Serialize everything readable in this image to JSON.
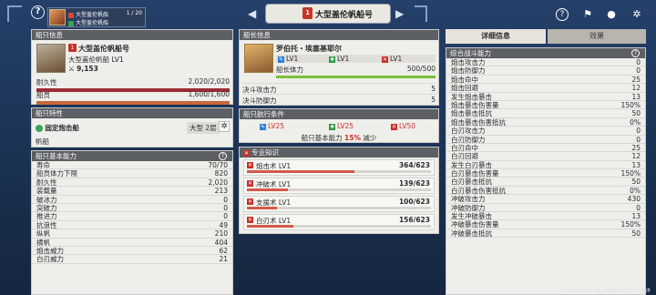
{
  "topbar": {
    "help": "?",
    "ship_card": {
      "name1": "大型盖伦帆船",
      "name2": "大型盖伦帆船",
      "page": "1 / 20"
    },
    "title": "大型盖伦帆船号",
    "title_badge": "1",
    "icons": [
      "question-icon",
      "flag-icon",
      "chat-icon",
      "settings-icon"
    ]
  },
  "ship_info": {
    "header": "船只信息",
    "badge": "1",
    "name": "大型盖伦帆船号",
    "type": "大型盖伦帆船 LV1",
    "power": "9,153",
    "durability_label": "耐久性",
    "durability_value": "2,020/2,020",
    "durability_fill": 1.0,
    "sailors_label": "船员",
    "sailors_value": "1,600/1,600",
    "sailors_fill": 1.0,
    "colors": {
      "durability": "#9c2b36",
      "sailors": "#c7683a"
    }
  },
  "ship_traits": {
    "header": "船只特性",
    "trait": "固定炮击船",
    "size": "大型 2层",
    "kind": "帆船"
  },
  "ship_base": {
    "header": "船只基本能力",
    "rows": [
      {
        "label": "寿命",
        "value": "70/70"
      },
      {
        "label": "船员体力下限",
        "value": "820"
      },
      {
        "label": "耐久性",
        "value": "2,020"
      },
      {
        "label": "装载量",
        "value": "213"
      },
      {
        "label": "破冰力",
        "value": "0"
      },
      {
        "label": "突破力",
        "value": "0"
      },
      {
        "label": "推进力",
        "value": "0"
      },
      {
        "label": "抗浪性",
        "value": "49"
      },
      {
        "label": "纵帆",
        "value": "210"
      },
      {
        "label": "横帆",
        "value": "404"
      },
      {
        "label": "炮击威力",
        "value": "62"
      },
      {
        "label": "白刃威力",
        "value": "21"
      }
    ]
  },
  "captain": {
    "header": "船长信息",
    "name": "罗伯托・埃塞基耶尔",
    "lv1": "LV1",
    "lv2": "LV1",
    "lv3": "LV1",
    "stamina_label": "船长体力",
    "stamina_value": "500/500",
    "stamina_fill": 1.0,
    "atk_label": "决斗攻击力",
    "atk_value": "5",
    "def_label": "决斗防御力",
    "def_value": "5"
  },
  "voyage": {
    "header": "船只航行条件",
    "c1": "LV25",
    "c2": "LV25",
    "c3": "LV50",
    "note_prefix": "船只基本能力",
    "note_pct": "15%",
    "note_suffix": "减少"
  },
  "skills": {
    "header": "专业知识",
    "items": [
      {
        "name": "炮击术 LV1",
        "value": "364/623",
        "fill": 0.584
      },
      {
        "name": "冲破术 LV1",
        "value": "139/623",
        "fill": 0.223
      },
      {
        "name": "支援术 LV1",
        "value": "100/623",
        "fill": 0.161
      },
      {
        "name": "白刃术 LV1",
        "value": "156/623",
        "fill": 0.25
      }
    ]
  },
  "tabs": {
    "detail": "详细信息",
    "effect": "效果"
  },
  "combat": {
    "header": "综合战斗能力",
    "rows": [
      {
        "label": "炮击攻击力",
        "value": "0"
      },
      {
        "label": "炮击防御力",
        "value": "0"
      },
      {
        "label": "炮击命中",
        "value": "25"
      },
      {
        "label": "炮击回避",
        "value": "12"
      },
      {
        "label": "发生炮击暴击",
        "value": "13"
      },
      {
        "label": "炮击暴击伤害量",
        "value": "150%"
      },
      {
        "label": "炮击暴击抵抗",
        "value": "50"
      },
      {
        "label": "炮击暴击伤害抵抗",
        "value": "0%"
      },
      {
        "label": "白刃攻击力",
        "value": "0"
      },
      {
        "label": "白刃防御力",
        "value": "0"
      },
      {
        "label": "白刃命中",
        "value": "25"
      },
      {
        "label": "白刃回避",
        "value": "12"
      },
      {
        "label": "发生白刃暴击",
        "value": "13"
      },
      {
        "label": "白刃暴击伤害量",
        "value": "150%"
      },
      {
        "label": "白刃暴击抵抗",
        "value": "50"
      },
      {
        "label": "白刃暴击伤害抵抗",
        "value": "0%"
      },
      {
        "label": "冲破攻击力",
        "value": "430"
      },
      {
        "label": "冲破防御力",
        "value": "0"
      },
      {
        "label": "发生冲破暴击",
        "value": "13"
      },
      {
        "label": "冲破暴击伤害量",
        "value": "150%"
      },
      {
        "label": "冲破暴击抵抗",
        "value": "50"
      }
    ]
  },
  "version": "1.0220.091.68 2608031112 大西洋"
}
